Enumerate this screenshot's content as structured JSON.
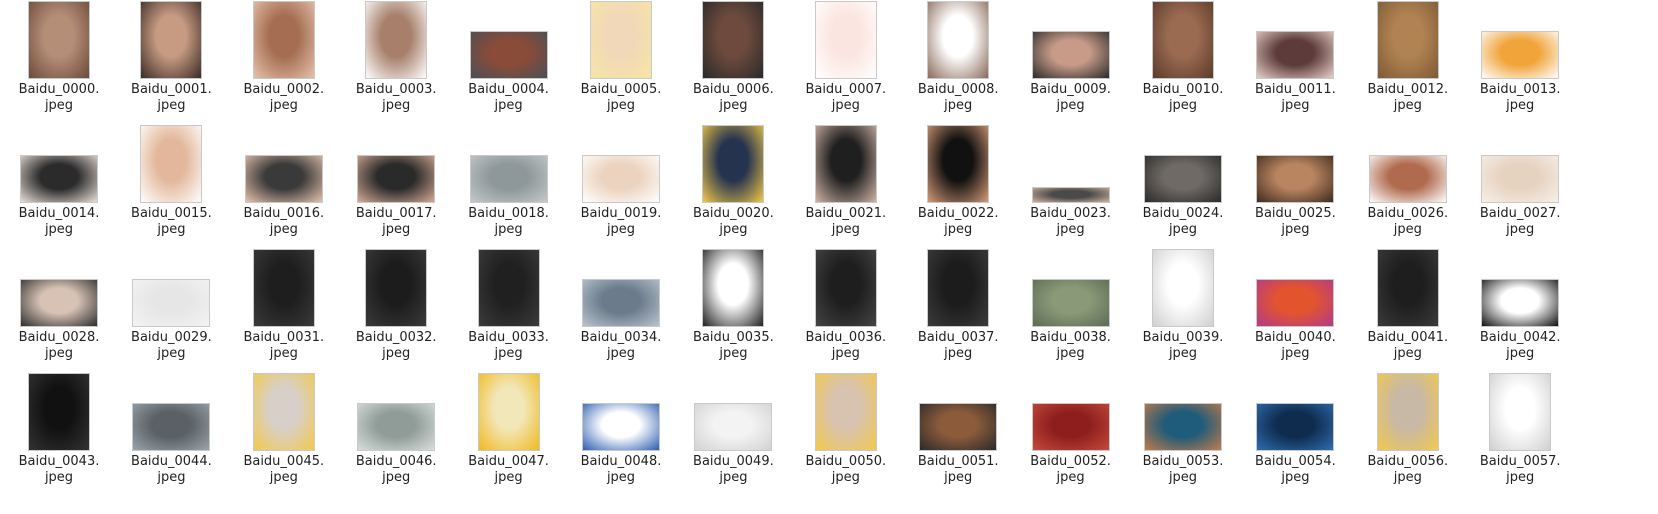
{
  "files": [
    {
      "name": "Baidu_0000.",
      "ext": "jpeg",
      "icon": "face-portrait-thumbnail",
      "c1": "#b58e78",
      "c2": "#6b4a3a",
      "shape": "portrait"
    },
    {
      "name": "Baidu_0001.",
      "ext": "jpeg",
      "icon": "face-portrait-thumbnail",
      "c1": "#c79b82",
      "c2": "#3a2b26",
      "shape": "portrait"
    },
    {
      "name": "Baidu_0002.",
      "ext": "jpeg",
      "icon": "face-grid-thumbnail",
      "c1": "#a56e52",
      "c2": "#e5c2ab",
      "shape": "portrait"
    },
    {
      "name": "Baidu_0003.",
      "ext": "jpeg",
      "icon": "anatomy-face-thumbnail",
      "c1": "#a77f6a",
      "c2": "#ffffff",
      "shape": "portrait"
    },
    {
      "name": "Baidu_0004.",
      "ext": "jpeg",
      "icon": "face-portrait-thumbnail",
      "c1": "#8a4b38",
      "c2": "#4b4f58",
      "shape": "landscape"
    },
    {
      "name": "Baidu_0005.",
      "ext": "jpeg",
      "icon": "face-portrait-thumbnail",
      "c1": "#f1d8b8",
      "c2": "#f6e6a4",
      "shape": "portrait"
    },
    {
      "name": "Baidu_0006.",
      "ext": "jpeg",
      "icon": "face-portrait-thumbnail",
      "c1": "#6d4a3d",
      "c2": "#2a2a2a",
      "shape": "portrait"
    },
    {
      "name": "Baidu_0007.",
      "ext": "jpeg",
      "icon": "face-drawing-thumbnail",
      "c1": "#fbe5e0",
      "c2": "#ffffff",
      "shape": "portrait"
    },
    {
      "name": "Baidu_0008.",
      "ext": "jpeg",
      "icon": "face-collage-thumbnail",
      "c1": "#ffffff",
      "c2": "#8a6a5a",
      "shape": "portrait"
    },
    {
      "name": "Baidu_0009.",
      "ext": "jpeg",
      "icon": "face-warp-thumbnail",
      "c1": "#c79b88",
      "c2": "#2b2b2b",
      "shape": "landscape"
    },
    {
      "name": "Baidu_0010.",
      "ext": "jpeg",
      "icon": "face-portrait-thumbnail",
      "c1": "#9b6b51",
      "c2": "#5a3b2a",
      "shape": "portrait"
    },
    {
      "name": "Baidu_0011.",
      "ext": "jpeg",
      "icon": "face-pair-thumbnail",
      "c1": "#5c3b3a",
      "c2": "#e8d0c8",
      "shape": "landscape"
    },
    {
      "name": "Baidu_0012.",
      "ext": "jpeg",
      "icon": "face-portrait-thumbnail",
      "c1": "#b28352",
      "c2": "#7d5a36",
      "shape": "portrait"
    },
    {
      "name": "Baidu_0013.",
      "ext": "jpeg",
      "icon": "face-diagram-thumbnail",
      "c1": "#f0a43a",
      "c2": "#ffffff",
      "shape": "landscape"
    },
    {
      "name": "Baidu_0014.",
      "ext": "jpeg",
      "icon": "software-screenshot-thumbnail",
      "c1": "#2b2b2b",
      "c2": "#e9dfd8",
      "shape": "landscape"
    },
    {
      "name": "Baidu_0015.",
      "ext": "jpeg",
      "icon": "face-grid-thumbnail",
      "c1": "#e3b79b",
      "c2": "#ffffff",
      "shape": "portrait"
    },
    {
      "name": "Baidu_0016.",
      "ext": "jpeg",
      "icon": "face-pair-thumbnail",
      "c1": "#3a3a3a",
      "c2": "#e6c2ad",
      "shape": "landscape"
    },
    {
      "name": "Baidu_0017.",
      "ext": "jpeg",
      "icon": "face-pair-thumbnail",
      "c1": "#2a2a2a",
      "c2": "#d7aa94",
      "shape": "landscape"
    },
    {
      "name": "Baidu_0018.",
      "ext": "jpeg",
      "icon": "face-3d-model-thumbnail",
      "c1": "#8e9799",
      "c2": "#c4c9cb",
      "shape": "landscape"
    },
    {
      "name": "Baidu_0019.",
      "ext": "jpeg",
      "icon": "face-3d-model-thumbnail",
      "c1": "#ecd3bf",
      "c2": "#ffffff",
      "shape": "landscape"
    },
    {
      "name": "Baidu_0020.",
      "ext": "jpeg",
      "icon": "face-portrait-thumbnail",
      "c1": "#25334f",
      "c2": "#f1c84a",
      "shape": "portrait"
    },
    {
      "name": "Baidu_0021.",
      "ext": "jpeg",
      "icon": "face-portrait-thumbnail",
      "c1": "#1f1f1f",
      "c2": "#cfb3a6",
      "shape": "portrait"
    },
    {
      "name": "Baidu_0022.",
      "ext": "jpeg",
      "icon": "face-portrait-thumbnail",
      "c1": "#111111",
      "c2": "#d59a76",
      "shape": "portrait"
    },
    {
      "name": "Baidu_0023.",
      "ext": "jpeg",
      "icon": "face-strip-thumbnail",
      "c1": "#4a4a4a",
      "c2": "#d0b29e",
      "shape": "strip"
    },
    {
      "name": "Baidu_0024.",
      "ext": "jpeg",
      "icon": "face-portrait-thumbnail",
      "c1": "#6f6a66",
      "c2": "#2b2b2b",
      "shape": "landscape"
    },
    {
      "name": "Baidu_0025.",
      "ext": "jpeg",
      "icon": "face-portrait-thumbnail",
      "c1": "#b98460",
      "c2": "#3e2a1f",
      "shape": "landscape"
    },
    {
      "name": "Baidu_0026.",
      "ext": "jpeg",
      "icon": "face-3d-model-thumbnail",
      "c1": "#b06a4e",
      "c2": "#ffffff",
      "shape": "landscape"
    },
    {
      "name": "Baidu_0027.",
      "ext": "jpeg",
      "icon": "face-render-thumbnail",
      "c1": "#e7d2c0",
      "c2": "#f6efe8",
      "shape": "landscape"
    },
    {
      "name": "Baidu_0028.",
      "ext": "jpeg",
      "icon": "software-screenshot-thumbnail",
      "c1": "#d7c2b5",
      "c2": "#2d2d2d",
      "shape": "landscape"
    },
    {
      "name": "Baidu_0029.",
      "ext": "jpeg",
      "icon": "logo-thumbnail",
      "c1": "#e6e6e6",
      "c2": "#f3f3f3",
      "shape": "landscape"
    },
    {
      "name": "Baidu_0031.",
      "ext": "jpeg",
      "icon": "phone-screenshot-thumbnail",
      "c1": "#1e1e1e",
      "c2": "#3a3a3a",
      "shape": "portrait"
    },
    {
      "name": "Baidu_0032.",
      "ext": "jpeg",
      "icon": "phone-screenshot-thumbnail",
      "c1": "#1c1c1c",
      "c2": "#3a3a3a",
      "shape": "portrait"
    },
    {
      "name": "Baidu_0033.",
      "ext": "jpeg",
      "icon": "phone-screenshot-thumbnail",
      "c1": "#202020",
      "c2": "#3b3b3b",
      "shape": "portrait"
    },
    {
      "name": "Baidu_0034.",
      "ext": "jpeg",
      "icon": "turnstile-photo-thumbnail",
      "c1": "#6b7b8c",
      "c2": "#b9c3cd",
      "shape": "landscape"
    },
    {
      "name": "Baidu_0035.",
      "ext": "jpeg",
      "icon": "face-device-thumbnail",
      "c1": "#ffffff",
      "c2": "#202020",
      "shape": "portrait"
    },
    {
      "name": "Baidu_0036.",
      "ext": "jpeg",
      "icon": "phone-screenshot-thumbnail",
      "c1": "#1e1e1e",
      "c2": "#444444",
      "shape": "portrait"
    },
    {
      "name": "Baidu_0037.",
      "ext": "jpeg",
      "icon": "phone-screenshot-thumbnail",
      "c1": "#1c1c1c",
      "c2": "#3b3b3b",
      "shape": "portrait"
    },
    {
      "name": "Baidu_0038.",
      "ext": "jpeg",
      "icon": "turnstile-photo-thumbnail",
      "c1": "#8a9a78",
      "c2": "#5d6a55",
      "shape": "landscape"
    },
    {
      "name": "Baidu_0039.",
      "ext": "jpeg",
      "icon": "face-kiosk-thumbnail",
      "c1": "#ffffff",
      "c2": "#cfcfcf",
      "shape": "portrait"
    },
    {
      "name": "Baidu_0040.",
      "ext": "jpeg",
      "icon": "gradient-banner-thumbnail",
      "c1": "#e3542e",
      "c2": "#b23a8a",
      "shape": "landscape"
    },
    {
      "name": "Baidu_0041.",
      "ext": "jpeg",
      "icon": "phone-screenshot-thumbnail",
      "c1": "#1e1e1e",
      "c2": "#3a3a3a",
      "shape": "portrait"
    },
    {
      "name": "Baidu_0042.",
      "ext": "jpeg",
      "icon": "face-device-thumbnail",
      "c1": "#ffffff",
      "c2": "#111111",
      "shape": "landscape"
    },
    {
      "name": "Baidu_0043.",
      "ext": "jpeg",
      "icon": "phone-screenshot-thumbnail",
      "c1": "#111111",
      "c2": "#333333",
      "shape": "portrait"
    },
    {
      "name": "Baidu_0044.",
      "ext": "jpeg",
      "icon": "turnstile-photo-thumbnail",
      "c1": "#596066",
      "c2": "#9aa4aa",
      "shape": "landscape"
    },
    {
      "name": "Baidu_0045.",
      "ext": "jpeg",
      "icon": "tv-show-thumbnail",
      "c1": "#d8d0c8",
      "c2": "#f2c94c",
      "shape": "portrait"
    },
    {
      "name": "Baidu_0046.",
      "ext": "jpeg",
      "icon": "turnstile-photo-thumbnail",
      "c1": "#8f9c97",
      "c2": "#d9dfdc",
      "shape": "landscape"
    },
    {
      "name": "Baidu_0047.",
      "ext": "jpeg",
      "icon": "cartoon-thumbnail",
      "c1": "#f2e7b8",
      "c2": "#f0b91f",
      "shape": "portrait"
    },
    {
      "name": "Baidu_0048.",
      "ext": "jpeg",
      "icon": "document-screenshot-thumbnail",
      "c1": "#ffffff",
      "c2": "#2a5db0",
      "shape": "landscape"
    },
    {
      "name": "Baidu_0049.",
      "ext": "jpeg",
      "icon": "phone-screenshot-thumbnail",
      "c1": "#f3f3f3",
      "c2": "#d2d2d2",
      "shape": "landscape"
    },
    {
      "name": "Baidu_0050.",
      "ext": "jpeg",
      "icon": "tv-show-thumbnail",
      "c1": "#d8c2b0",
      "c2": "#f2c94c",
      "shape": "portrait"
    },
    {
      "name": "Baidu_0051.",
      "ext": "jpeg",
      "icon": "door-lock-thumbnail",
      "c1": "#8b5b3a",
      "c2": "#2a2a2a",
      "shape": "landscape"
    },
    {
      "name": "Baidu_0052.",
      "ext": "jpeg",
      "icon": "door-thumbnail",
      "c1": "#8e1e1e",
      "c2": "#c44a3a",
      "shape": "landscape"
    },
    {
      "name": "Baidu_0053.",
      "ext": "jpeg",
      "icon": "underwater-photo-thumbnail",
      "c1": "#1f5b7a",
      "c2": "#c27b4a",
      "shape": "landscape"
    },
    {
      "name": "Baidu_0054.",
      "ext": "jpeg",
      "icon": "dashboard-thumbnail",
      "c1": "#0f2c4e",
      "c2": "#2f6db0",
      "shape": "landscape"
    },
    {
      "name": "Baidu_0056.",
      "ext": "jpeg",
      "icon": "tv-show-thumbnail",
      "c1": "#c8b8a6",
      "c2": "#f2c94c",
      "shape": "portrait"
    },
    {
      "name": "Baidu_0057.",
      "ext": "jpeg",
      "icon": "metal-detector-thumbnail",
      "c1": "#ffffff",
      "c2": "#cfcfcf",
      "shape": "portrait"
    }
  ]
}
